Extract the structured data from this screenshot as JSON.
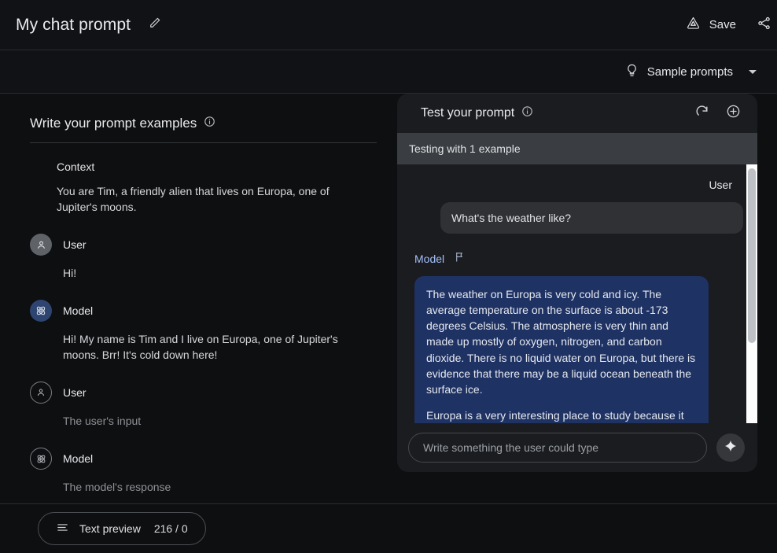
{
  "header": {
    "doc_title": "My chat prompt",
    "edit_icon": "pencil-icon",
    "save_label": "Save",
    "save_icon": "save-triangle-icon",
    "share_icon": "share-icon"
  },
  "sample_bar": {
    "label": "Sample prompts",
    "icon": "lightbulb-icon",
    "caret": "chevron-down-icon"
  },
  "left_panel": {
    "heading": "Write your prompt examples",
    "info_icon": "info-icon",
    "context_label": "Context",
    "context_text": "You are Tim, a friendly alien that lives on Europa, one of Jupiter's moons.",
    "turns": [
      {
        "role": "User",
        "text": "Hi!",
        "avatar": "user-avatar-icon",
        "filled": true,
        "placeholder": false
      },
      {
        "role": "Model",
        "text": "Hi! My name is Tim and I live on Europa, one of Jupiter's moons. Brr! It's cold down here!",
        "avatar": "model-atom-icon",
        "filled": true,
        "placeholder": false
      },
      {
        "role": "User",
        "text": "The user's input",
        "avatar": "user-avatar-icon",
        "filled": false,
        "placeholder": true
      },
      {
        "role": "Model",
        "text": "The model's response",
        "avatar": "model-atom-icon",
        "filled": false,
        "placeholder": true
      }
    ]
  },
  "right_panel": {
    "title": "Test your prompt",
    "info_icon": "info-icon",
    "refresh_icon": "refresh-icon",
    "add_icon": "add-circle-icon",
    "testing_status": "Testing with 1 example",
    "user_role": "User",
    "user_message": "What's the weather like?",
    "model_role": "Model",
    "flag_icon": "flag-icon",
    "model_paragraph_1": "The weather on Europa is very cold and icy. The average temperature on the surface is about -173 degrees Celsius. The atmosphere is very thin and made up mostly of oxygen, nitrogen, and carbon dioxide. There is no liquid water on Europa, but there is evidence that there may be a liquid ocean beneath the surface ice.",
    "model_paragraph_2": "Europa is a very interesting place to study because it",
    "composer_placeholder": "Write something the user could type",
    "composer_value": "",
    "send_icon": "sparkle-icon"
  },
  "footer": {
    "preview_label": "Text preview",
    "preview_count": "216 / 0",
    "preview_icon": "list-lines-icon"
  },
  "colors": {
    "page_bg": "#0e0f11",
    "panel_bg": "#1b1c1f",
    "testing_bar_bg": "#3a3d41",
    "model_bubble_bg": "#1e3264",
    "user_bubble_bg": "#303134",
    "model_role_text": "#a3bffa",
    "model_avatar_bg": "#2f4571",
    "user_avatar_bg": "#5f6368"
  }
}
